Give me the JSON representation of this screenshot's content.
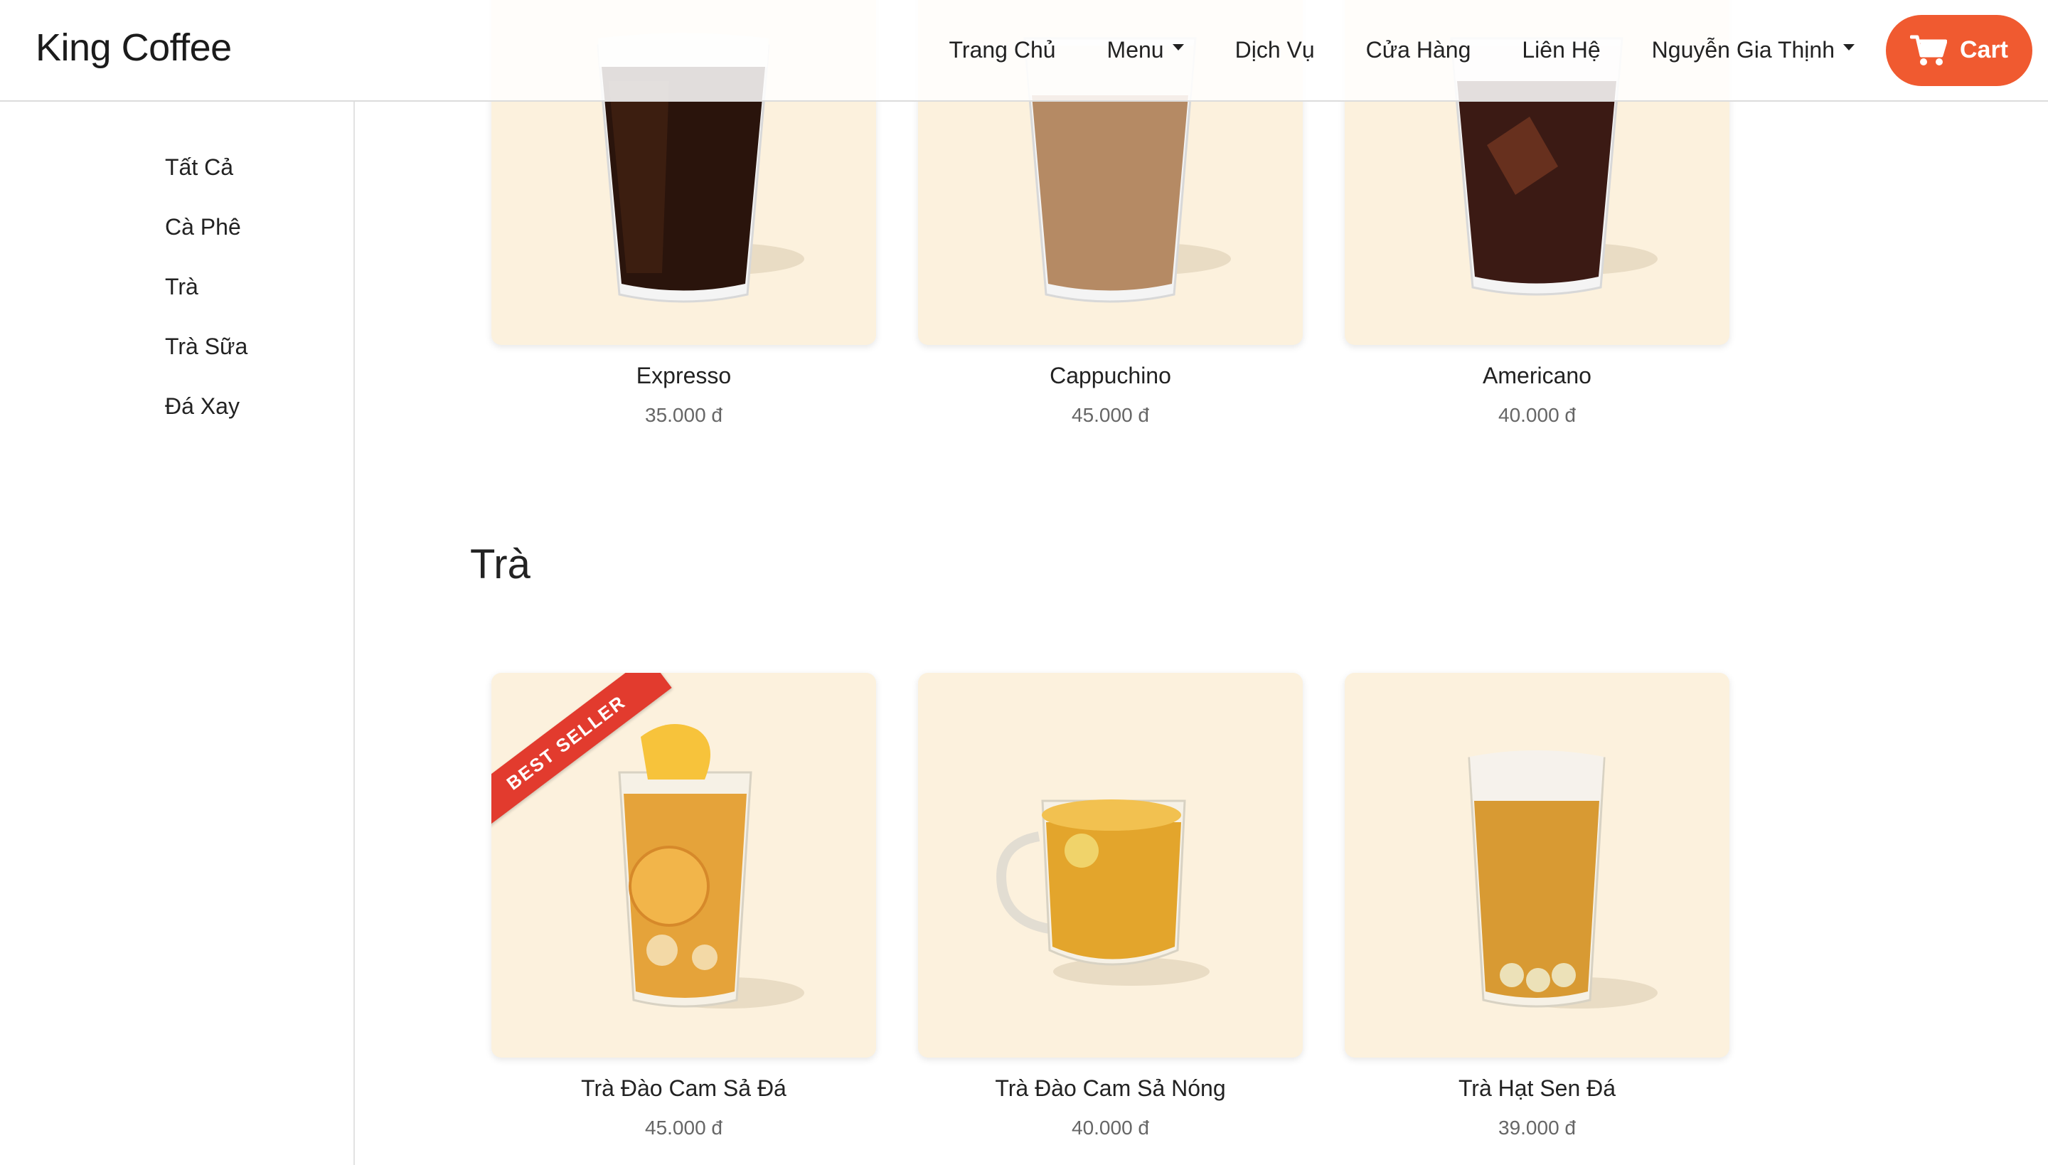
{
  "brand": "King Coffee",
  "nav": {
    "home": "Trang Chủ",
    "menu": "Menu",
    "services": "Dịch Vụ",
    "stores": "Cửa Hàng",
    "contact": "Liên Hệ",
    "user": "Nguyễn Gia Thịnh",
    "cart": "Cart"
  },
  "sidebar": {
    "items": [
      {
        "label": "Tất Cả"
      },
      {
        "label": "Cà Phê"
      },
      {
        "label": "Trà"
      },
      {
        "label": "Trà Sữa"
      },
      {
        "label": "Đá Xay"
      }
    ]
  },
  "coffee_products": [
    {
      "name": "Expresso",
      "price": "35.000 đ"
    },
    {
      "name": "Cappuchino",
      "price": "45.000 đ"
    },
    {
      "name": "Americano",
      "price": "40.000 đ"
    }
  ],
  "tea_section": {
    "title": "Trà",
    "products": [
      {
        "name": "Trà Đào Cam Sả Đá",
        "price": "45.000 đ",
        "badge": "BEST SELLER"
      },
      {
        "name": "Trà Đào Cam Sả Nóng",
        "price": "40.000 đ"
      },
      {
        "name": "Trà Hạt Sen Đá",
        "price": "39.000 đ"
      }
    ]
  },
  "colors": {
    "accent": "#f05a30",
    "card_bg": "#fcf1dd",
    "ribbon": "#e23b2e"
  },
  "icons": {
    "cart": "shopping-cart-icon"
  }
}
